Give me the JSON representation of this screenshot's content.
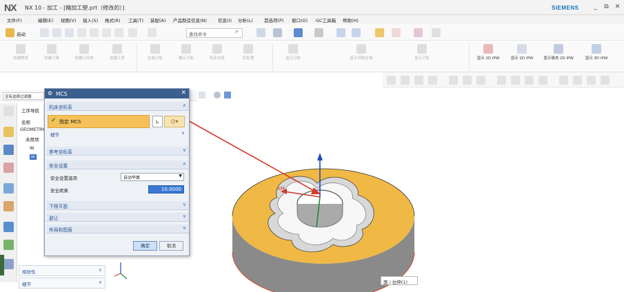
{
  "window": {
    "logo": "NX",
    "title": "NX 10 - 加工 - [精加工塑.prt（修改的）]",
    "brand": "SIEMENS",
    "controls": [
      "_",
      "⧉",
      "✕"
    ]
  },
  "menubar": {
    "items": [
      "文件(F)",
      "编辑(E)",
      "视图(V)",
      "插入(S)",
      "格式(R)",
      "工具(T)",
      "装配(A)",
      "产品制造信息(N)",
      "信息(I)",
      "分析(L)",
      "首选项(P)",
      "窗口(O)",
      "GC工具箱",
      "帮助(H)"
    ]
  },
  "toolbar": {
    "start_label": "启动",
    "command_search_placeholder": "查找命令"
  },
  "ribbon": {
    "groups": [
      {
        "label": "创建程序"
      },
      {
        "label": "创建刀具"
      },
      {
        "label": "创建几何体"
      },
      {
        "label": "创建工序"
      },
      {
        "label": "生成刀轨"
      },
      {
        "label": "确认刀轨"
      },
      {
        "label": "机床仿真"
      },
      {
        "label": "后处理"
      },
      {
        "label": "显示刀轨"
      },
      {
        "label": "显示切削区域"
      },
      {
        "label": "显示刀轨"
      }
    ],
    "ipw": [
      {
        "label": "显示 2D IPW"
      },
      {
        "label": "显示 2D IPW"
      },
      {
        "label": "显示填充 2D IPW"
      },
      {
        "label": "显示 3D IPW"
      }
    ]
  },
  "filter": {
    "value": "没有选择过滤器"
  },
  "navigator": {
    "title": "工序导航",
    "column": "名称",
    "root": "GEOMETRY",
    "nodes": [
      "未用项",
      "W",
      "M"
    ]
  },
  "bottom_panels": [
    {
      "label": "相依性",
      "chevron": "∨"
    },
    {
      "label": "细节",
      "chevron": "∨"
    }
  ],
  "dialog": {
    "title": "MCS",
    "sections": {
      "machine_csys": "机床坐标系",
      "specify_mcs": "指定 MCS",
      "details": "细节",
      "reference_csys": "参考坐标系",
      "safety": "安全设置",
      "safety_option_label": "安全设置选项",
      "safety_option_value": "自动平面",
      "safety_distance_label": "安全距离",
      "safety_distance_value": "10.0000",
      "lower_plane": "下限平面",
      "avoid": "避让",
      "layout": "布局和图层"
    },
    "ok": "确定",
    "cancel": "取消"
  },
  "viewport": {
    "axis_label": "XM",
    "status_tip": "面 / 拉伸(1)"
  },
  "colors": {
    "accent": "#3b5f8e",
    "part_face": "#f0b945",
    "part_side": "#8a8a8a",
    "arrow": "#d83a2a",
    "highlight": "#f5c15a"
  }
}
